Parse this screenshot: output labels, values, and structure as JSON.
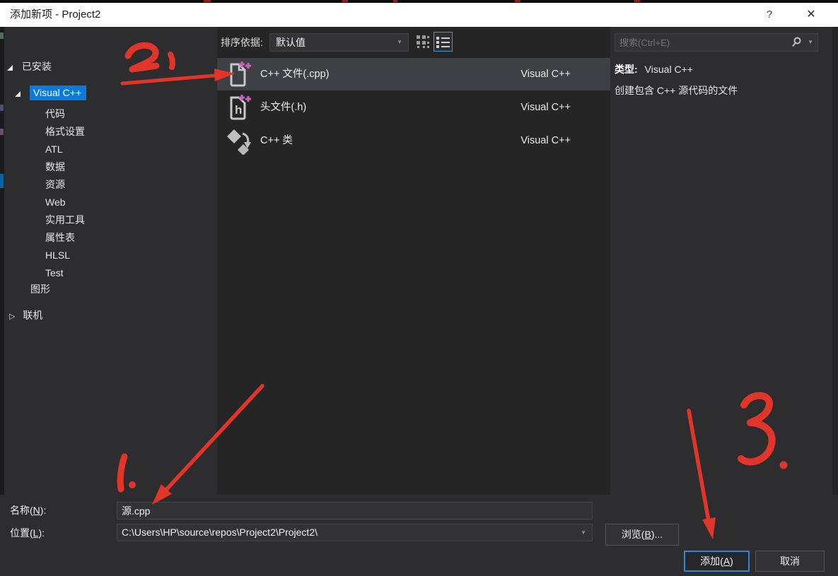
{
  "title_bar": {
    "title": "添加新项 - Project2",
    "help": "?",
    "close": "✕"
  },
  "sidebar": {
    "installed": "已安装",
    "selected_node": "Visual C++",
    "children": [
      "代码",
      "格式设置",
      "ATL",
      "数据",
      "资源",
      "Web",
      "实用工具",
      "属性表",
      "HLSL",
      "Test"
    ],
    "graphics": "图形",
    "online": "联机"
  },
  "toolbar": {
    "sort_label": "排序依据:",
    "sort_value": "默认值"
  },
  "templates": [
    {
      "name": "C++ 文件(.cpp)",
      "category": "Visual C++",
      "icon": "cpp-file-icon",
      "selected": true
    },
    {
      "name": "头文件(.h)",
      "category": "Visual C++",
      "icon": "header-file-icon",
      "selected": false
    },
    {
      "name": "C++ 类",
      "category": "Visual C++",
      "icon": "cpp-class-icon",
      "selected": false
    }
  ],
  "details": {
    "search_placeholder": "搜索(Ctrl+E)",
    "type_label": "类型:",
    "type_value": "Visual C++",
    "description": "创建包含 C++ 源代码的文件"
  },
  "footer": {
    "name_pre": "名称(",
    "name_key": "N",
    "name_post": "):",
    "name_value": "源.cpp",
    "location_pre": "位置(",
    "location_key": "L",
    "location_post": "):",
    "location_value": "C:\\Users\\HP\\source\\repos\\Project2\\Project2\\",
    "browse_pre": "浏览(",
    "browse_key": "B",
    "browse_post": ")...",
    "add_pre": "添加(",
    "add_key": "A",
    "add_post": ")",
    "cancel": "取消"
  },
  "annotations": {
    "step1": "1.",
    "step2": "2,",
    "step3": "3.",
    "color": "#e23529"
  },
  "colors": {
    "accent_blue": "#0c7ad8",
    "selection_gray": "#3f3f46",
    "annotation_red": "#e23529",
    "template_plus_pink": "#c75fc7",
    "panel_dark": "#252526",
    "panel_light": "#2d2d30"
  }
}
